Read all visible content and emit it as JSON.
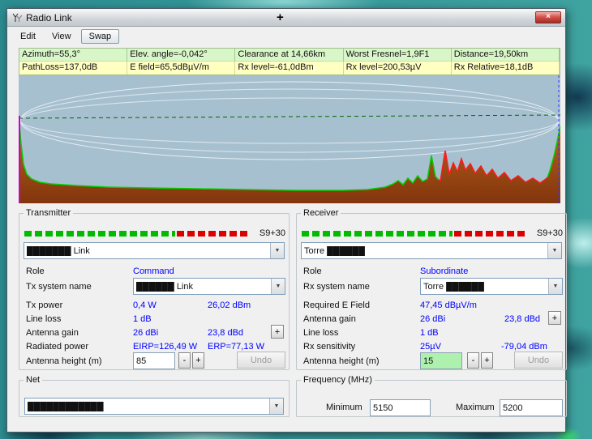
{
  "colors": {
    "accent_blue": "#0000ff",
    "info_green": "#d9f6c9",
    "info_yellow": "#ffffc2",
    "meter_green": "#00bb00",
    "meter_red": "#dd0000",
    "chart_bg": "#a7c0d0",
    "changed_field_bg": "#aef0ae"
  },
  "icons": {
    "dropdown": "▼",
    "close": "×",
    "cursor": "+"
  },
  "window": {
    "title": "Radio Link"
  },
  "menu": {
    "items": [
      "Edit",
      "View",
      "Swap"
    ]
  },
  "info": {
    "row1": [
      "Azimuth=55,3°",
      "Elev. angle=-0,042°",
      "Clearance at 14,66km",
      "Worst Fresnel=1,9F1",
      "Distance=19,50km"
    ],
    "row2": [
      "PathLoss=137,0dB",
      "E field=65,5dBµV/m",
      "Rx level=-61,0dBm",
      "Rx level=200,53µV",
      "Rx Relative=18,1dB"
    ]
  },
  "controls": {
    "minus": "-",
    "plus": "+",
    "undo": "Undo"
  },
  "tx": {
    "legend": "Transmitter",
    "s_meter": "S9+30",
    "unit_combo": "███████ Link",
    "role_label": "Role",
    "role_value": "Command",
    "system_label": "Tx system name",
    "system_value": "██████ Link",
    "power_label": "Tx power",
    "power_watts": "0,4 W",
    "power_dbm": "26,02 dBm",
    "line_loss_label": "Line loss",
    "line_loss_value": "1 dB",
    "gain_label": "Antenna gain",
    "gain_dbi": "26 dBi",
    "gain_dbd": "23,8 dBd",
    "radiated_label": "Radiated power",
    "eirp": "EIRP=126,49 W",
    "erp": "ERP=77,13 W",
    "height_label": "Antenna height (m)",
    "height_value": "85"
  },
  "rx": {
    "legend": "Receiver",
    "s_meter": "S9+30",
    "unit_combo": "Torre ██████",
    "role_label": "Role",
    "role_value": "Subordinate",
    "system_label": "Rx system name",
    "system_value": "Torre ██████",
    "efield_label": "Required E Field",
    "efield_value": "47,45 dBµV/m",
    "gain_label": "Antenna gain",
    "gain_dbi": "26 dBi",
    "gain_dbd": "23,8 dBd",
    "line_loss_label": "Line loss",
    "line_loss_value": "1 dB",
    "sens_label": "Rx sensitivity",
    "sens_uv": "25µV",
    "sens_dbm": "-79,04 dBm",
    "height_label": "Antenna height (m)",
    "height_value": "15"
  },
  "net": {
    "legend": "Net",
    "value": "████████████"
  },
  "freq": {
    "legend": "Frequency (MHz)",
    "min_label": "Minimum",
    "min_value": "5150",
    "max_label": "Maximum",
    "max_value": "5200"
  }
}
